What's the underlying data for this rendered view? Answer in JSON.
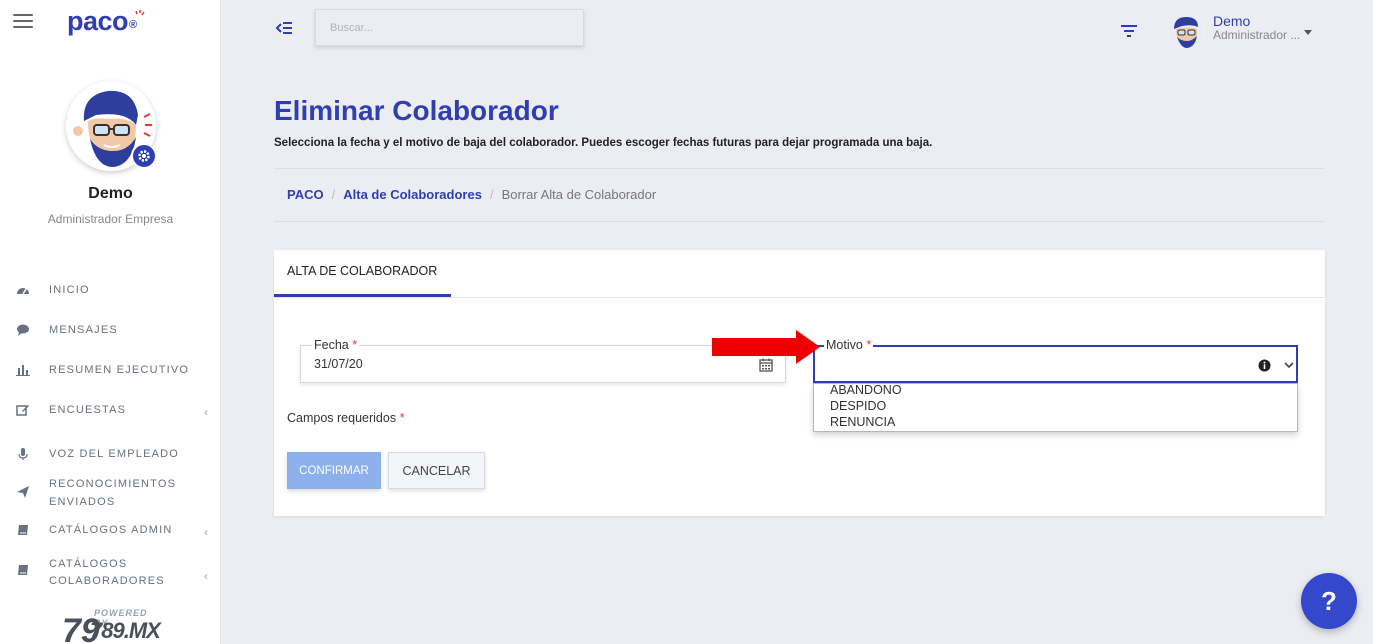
{
  "brand": {
    "logo_text": "paco",
    "logo_mark": "®"
  },
  "sidebar": {
    "user_name": "Demo",
    "user_role": "Administrador Empresa",
    "items": [
      {
        "label": "INICIO",
        "icon": "dashboard-icon",
        "has_chevron": false
      },
      {
        "label": "MENSAJES",
        "icon": "chat-bubble-icon",
        "has_chevron": false
      },
      {
        "label": "RESUMEN EJECUTIVO",
        "icon": "bar-chart-icon",
        "has_chevron": false
      },
      {
        "label": "ENCUESTAS",
        "icon": "edit-icon",
        "has_chevron": true
      },
      {
        "label": "VOZ DEL EMPLEADO",
        "icon": "microphone-icon",
        "has_chevron": false
      },
      {
        "label": "RECONOCIMIENTOS",
        "label2": "ENVIADOS",
        "icon": "paper-plane-icon",
        "has_chevron": false
      },
      {
        "label": "CATÁLOGOS ADMIN",
        "icon": "book-icon",
        "has_chevron": true
      },
      {
        "label": "CATÁLOGOS",
        "label2": "COLABORADORES",
        "icon": "book-icon",
        "has_chevron": true
      }
    ],
    "chevron": "‹",
    "powered_by": "POWERED BY",
    "powered_brand": "789.MX"
  },
  "topbar": {
    "search_placeholder": "Buscar...",
    "user_name": "Demo",
    "user_role": "Administrador ..."
  },
  "page": {
    "title": "Eliminar Colaborador",
    "subtitle": "Selecciona la fecha y el motivo de baja del colaborador. Puedes escoger fechas futuras para dejar programada una baja.",
    "breadcrumb": [
      {
        "label": "PACO",
        "link": true
      },
      {
        "label": "Alta de Colaboradores",
        "link": true
      },
      {
        "label": "Borrar Alta de Colaborador",
        "link": false
      }
    ],
    "breadcrumb_sep": "/"
  },
  "card": {
    "tab_label": "ALTA DE COLABORADOR",
    "fecha_label": "Fecha",
    "fecha_value": "31/07/20",
    "motivo_label": "Motivo",
    "required_mark": "*",
    "motivo_options": [
      "ABANDONO",
      "DESPIDO",
      "RENUNCIA"
    ],
    "campos_requeridos": "Campos requeridos",
    "confirm_label": "CONFIRMAR",
    "cancel_label": "CANCELAR"
  },
  "help": {
    "label": "?"
  },
  "colors": {
    "primary": "#2f3fb3",
    "required": "#e53935",
    "confirm_bg": "#8bb0ec",
    "arrow": "#ee0000"
  }
}
